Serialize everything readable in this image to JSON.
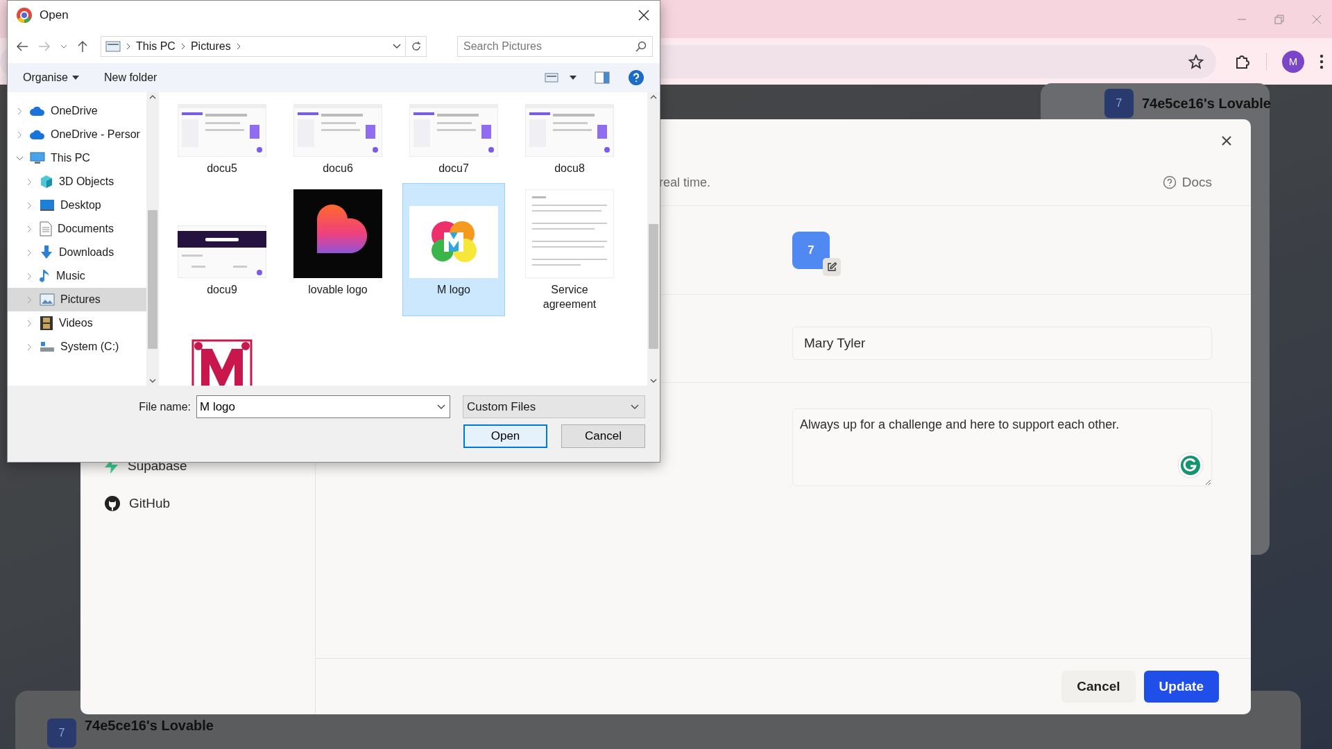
{
  "browser": {
    "profile_initial": "M"
  },
  "top_card": {
    "badge": "7",
    "title": "74e5ce16's Lovable"
  },
  "bottom_card": {
    "badge": "7",
    "title": "74e5ce16's Lovable"
  },
  "settings_modal": {
    "sidebar_items": [
      {
        "label": "Supabase",
        "kind": "supabase"
      },
      {
        "label": "GitHub",
        "kind": "github"
      }
    ],
    "description_tail": "real time.",
    "docs_link": "Docs",
    "avatar_initial": "7",
    "name_value": "Mary Tyler",
    "bio_value": "Always up for a challenge and here to support each other.",
    "buttons": [
      {
        "label": "Cancel",
        "kind": "secondary"
      },
      {
        "label": "Update",
        "kind": "primary"
      }
    ]
  },
  "file_dialog": {
    "title": "Open",
    "path": [
      "This PC",
      "Pictures"
    ],
    "search_placeholder": "Search Pictures",
    "toolbar": [
      "Organise",
      "New folder"
    ],
    "nav_items": [
      {
        "label": "OneDrive",
        "kind": "cloud",
        "selected": false,
        "expanded": false
      },
      {
        "label": "OneDrive - Persor",
        "kind": "cloud",
        "selected": false,
        "expanded": false
      },
      {
        "label": "This PC",
        "kind": "pc",
        "selected": false,
        "expanded": true,
        "children": [
          {
            "label": "3D Objects",
            "kind": "cube",
            "selected": false,
            "expanded": false
          },
          {
            "label": "Desktop",
            "kind": "desktop",
            "selected": false,
            "expanded": false
          },
          {
            "label": "Documents",
            "kind": "documents",
            "selected": false,
            "expanded": false
          },
          {
            "label": "Downloads",
            "kind": "downloads",
            "selected": false,
            "expanded": false
          },
          {
            "label": "Music",
            "kind": "music",
            "selected": false,
            "expanded": false
          },
          {
            "label": "Pictures",
            "kind": "pictures",
            "selected": true,
            "expanded": false
          },
          {
            "label": "Videos",
            "kind": "videos",
            "selected": false,
            "expanded": false
          },
          {
            "label": "System (C:)",
            "kind": "drive",
            "selected": false,
            "expanded": false
          }
        ]
      }
    ],
    "files": [
      {
        "name": "docu5",
        "kind": "screenshot",
        "selected": false
      },
      {
        "name": "docu6",
        "kind": "screenshot",
        "selected": false
      },
      {
        "name": "docu7",
        "kind": "screenshot",
        "selected": false
      },
      {
        "name": "docu8",
        "kind": "screenshot",
        "selected": false
      },
      {
        "name": "docu9",
        "kind": "banner",
        "selected": false
      },
      {
        "name": "lovable logo",
        "kind": "heart",
        "selected": false
      },
      {
        "name": "M logo",
        "kind": "splash",
        "selected": true
      },
      {
        "name": "Service agreement",
        "kind": "document",
        "selected": false
      },
      {
        "kind": "ornament",
        "selected": false
      }
    ],
    "file_name_label": "File name:",
    "file_name_value": "M logo",
    "file_type": "Custom Files",
    "buttons": [
      {
        "label": "Open",
        "kind": "default"
      },
      {
        "label": "Cancel",
        "kind": "normal"
      }
    ]
  }
}
